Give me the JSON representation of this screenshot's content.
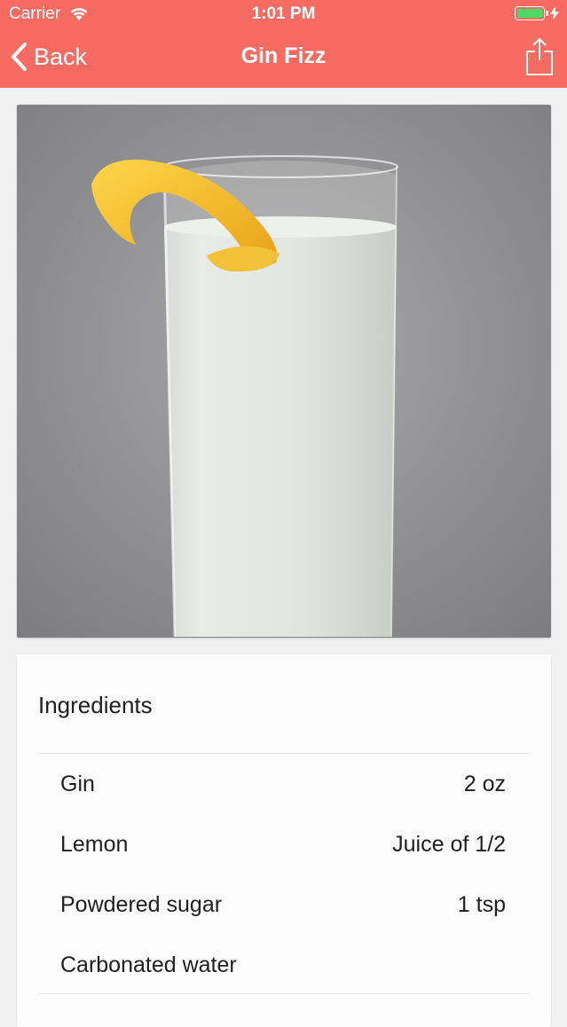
{
  "status_bar": {
    "carrier": "Carrier",
    "time": "1:01 PM",
    "battery_color": "#4cd964"
  },
  "nav": {
    "back_label": "Back",
    "title": "Gin Fizz",
    "share_icon": "share-icon",
    "background_color": "#f86b62"
  },
  "photo": {
    "icon": "cocktail-photo"
  },
  "ingredients": {
    "title": "Ingredients",
    "items": [
      {
        "name": "Gin",
        "amount": "2 oz"
      },
      {
        "name": "Lemon",
        "amount": "Juice of 1/2"
      },
      {
        "name": "Powdered sugar",
        "amount": "1 tsp"
      },
      {
        "name": "Carbonated water",
        "amount": ""
      }
    ]
  }
}
